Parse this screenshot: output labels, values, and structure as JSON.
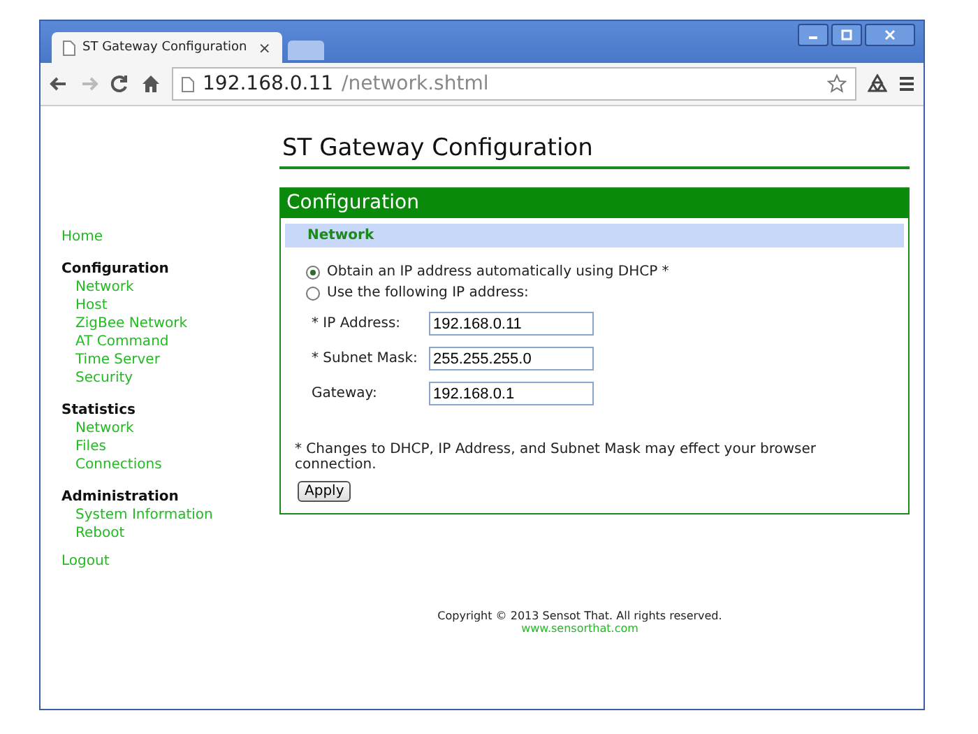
{
  "browser": {
    "tab_title": "ST Gateway Configuration",
    "tab_close": "×",
    "address_host": "192.168.0.11",
    "address_path": "/network.shtml"
  },
  "page_title": "ST Gateway Configuration",
  "sidebar": [
    {
      "kind": "link",
      "label": "Home"
    },
    {
      "kind": "group",
      "label": "Configuration",
      "children": [
        {
          "label": "Network"
        },
        {
          "label": "Host"
        },
        {
          "label": "ZigBee Network"
        },
        {
          "label": "AT Command"
        },
        {
          "label": "Time Server"
        },
        {
          "label": "Security"
        }
      ]
    },
    {
      "kind": "group",
      "label": "Statistics",
      "children": [
        {
          "label": "Network"
        },
        {
          "label": "Files"
        },
        {
          "label": "Connections"
        }
      ]
    },
    {
      "kind": "group",
      "label": "Administration",
      "children": [
        {
          "label": "System Information"
        },
        {
          "label": "Reboot"
        }
      ]
    },
    {
      "kind": "link",
      "label": "Logout"
    }
  ],
  "panel": {
    "title": "Configuration",
    "section": "Network",
    "radios": [
      {
        "label": "Obtain an IP address automatically using DHCP *",
        "selected": true
      },
      {
        "label": "Use the following IP address:",
        "selected": false
      }
    ],
    "fields": [
      {
        "label": "* IP Address:",
        "value": "192.168.0.11"
      },
      {
        "label": "* Subnet Mask:",
        "value": "255.255.255.0"
      },
      {
        "label": "Gateway:",
        "value": "192.168.0.1"
      }
    ],
    "note": "* Changes to DHCP, IP Address, and Subnet Mask may effect your browser connection.",
    "button": "Apply"
  },
  "footer": {
    "copyright": "Copyright © 2013 Sensot That. All rights reserved.",
    "link": "www.sensorthat.com"
  }
}
